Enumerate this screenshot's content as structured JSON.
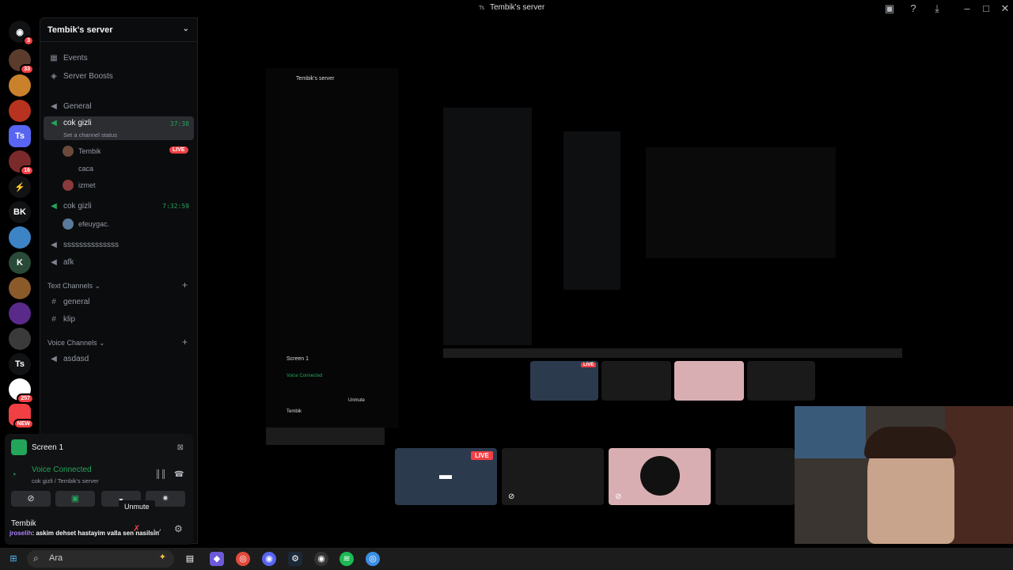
{
  "window": {
    "title": "Tembik's server"
  },
  "rail": {
    "icons": [
      {
        "name": "discord-home",
        "badge": "3"
      },
      {
        "name": "server-1",
        "badge": "33"
      },
      {
        "name": "server-2",
        "badge": ""
      },
      {
        "name": "server-3",
        "badge": ""
      },
      {
        "name": "server-ts",
        "label": "Ts",
        "badge": ""
      },
      {
        "name": "server-4",
        "badge": "16"
      },
      {
        "name": "server-5",
        "badge": ""
      },
      {
        "name": "server-bk",
        "label": "BK",
        "badge": ""
      },
      {
        "name": "server-6",
        "badge": ""
      },
      {
        "name": "server-7",
        "badge": ""
      },
      {
        "name": "server-8",
        "badge": ""
      },
      {
        "name": "server-9",
        "badge": ""
      },
      {
        "name": "server-10",
        "badge": ""
      },
      {
        "name": "server-ts2",
        "label": "Ts",
        "badge": ""
      },
      {
        "name": "server-11",
        "badge": "257"
      },
      {
        "name": "server-12",
        "badge": "NEW"
      }
    ]
  },
  "sidebar": {
    "server_name": "Tembik's server",
    "events": "Events",
    "server_boosts": "Server Boosts",
    "channels": {
      "general": "General",
      "cok_gizli_1": "cok gizli",
      "cok_gizli_1_time": "37:38",
      "channel_status": "Set a channel status",
      "users_1": [
        "Tembik",
        "caca",
        "izmet"
      ],
      "live_label": "LIVE",
      "cok_gizli_2": "cok gizli",
      "cok_gizli_2_time": "7:32:59",
      "users_2": [
        "efeuygac."
      ],
      "sss": "ssssssssssssss",
      "afk": "afk"
    },
    "text_channels_label": "Text Channels",
    "text_channels": [
      "general",
      "klip"
    ],
    "voice_channels_label": "Voice Channels",
    "voice_channels": [
      "asdasd"
    ]
  },
  "panel": {
    "screen_label": "Screen 1",
    "voice_connected": "Voice Connected",
    "voice_sub": "cok gizli / Tembik's server",
    "username": "Tembik",
    "tooltip": "Unmute",
    "chat_name": "jroselih",
    "chat_message": "askim dehset hastayim valla sen nasilsin"
  },
  "taskbar": {
    "search_placeholder": "Ara"
  },
  "stream": {
    "live_label": "LIVE",
    "inner_title": "Tembik's server",
    "inner_screen": "Screen 1",
    "inner_voice": "Voice Connected",
    "inner_user": "Tembik",
    "inner_unmute": "Unmute"
  },
  "colors": {
    "accent_green": "#23a55a",
    "live_red": "#f23f43",
    "bg_dark": "#0b0c0e"
  }
}
